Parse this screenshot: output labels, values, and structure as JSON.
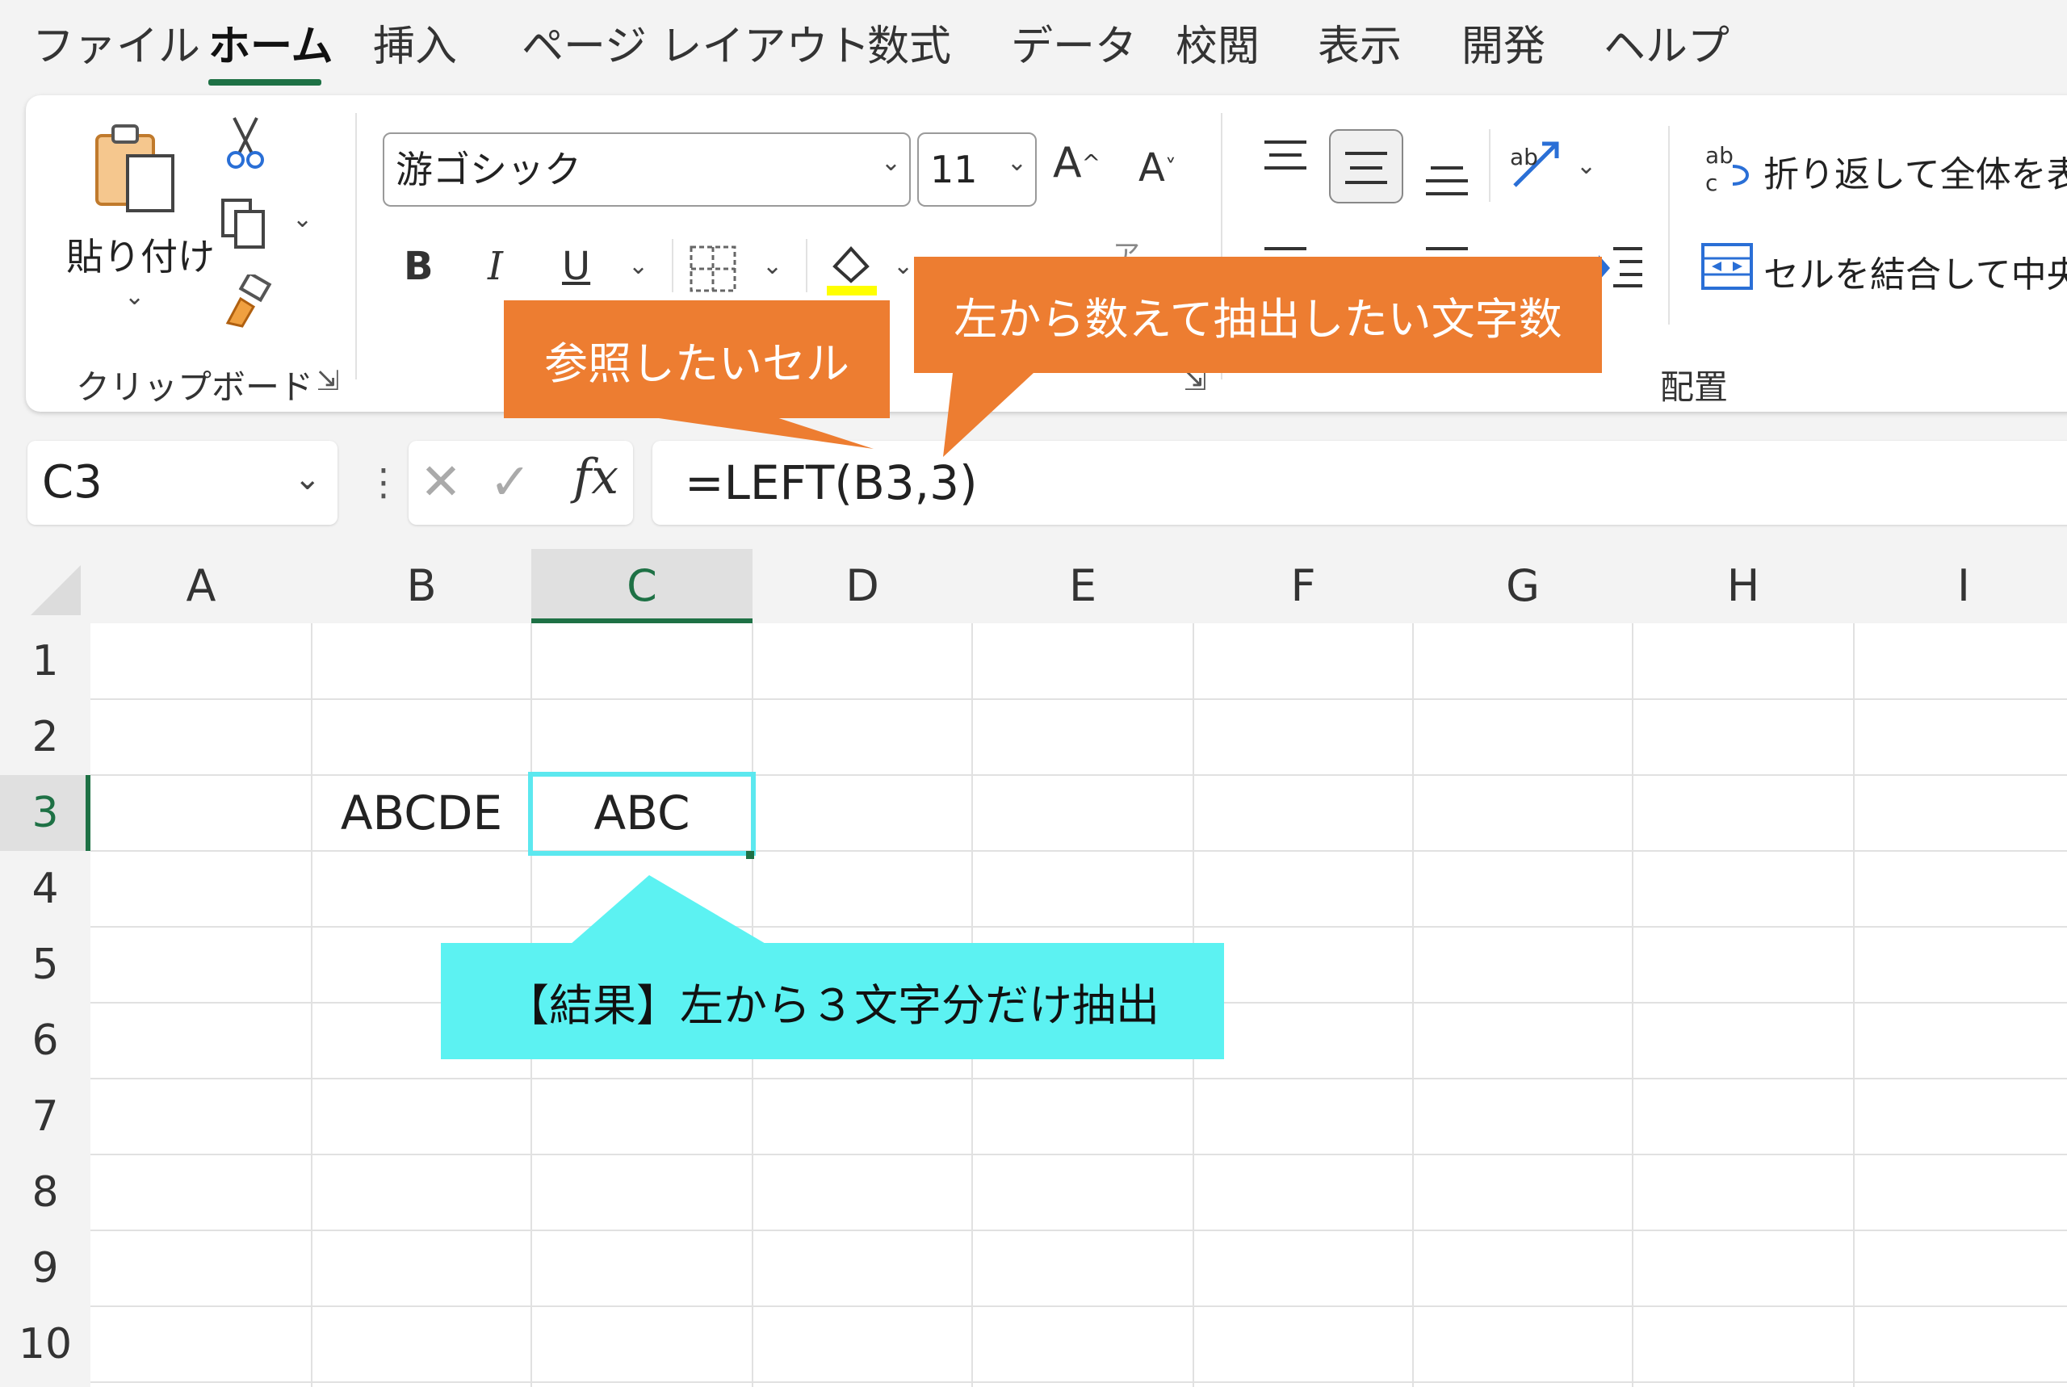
{
  "menu": {
    "tabs": [
      "ファイル",
      "ホーム",
      "挿入",
      "ページ レイアウト",
      "数式",
      "データ",
      "校閲",
      "表示",
      "開発",
      "ヘルプ"
    ],
    "active_tab": "ホーム"
  },
  "ribbon": {
    "clipboard": {
      "paste_label": "貼り付け",
      "group_label": "クリップボード"
    },
    "font": {
      "font_name": "游ゴシック",
      "font_size": "11",
      "grow_label": "A",
      "shrink_label": "A",
      "bold": "B",
      "italic": "I",
      "underline": "U"
    },
    "alignment": {
      "wrap_text": "折り返して全体を表",
      "merge_center": "セルを結合して中央",
      "group_label": "配置"
    }
  },
  "formula_bar": {
    "name_box": "C3",
    "fx_label": "fx",
    "formula": "=LEFT(B3,3)"
  },
  "sheet": {
    "columns": [
      "A",
      "B",
      "C",
      "D",
      "E",
      "F",
      "G",
      "H",
      "I"
    ],
    "rows": [
      "1",
      "2",
      "3",
      "4",
      "5",
      "6",
      "7",
      "8",
      "9",
      "10"
    ],
    "selected_cell": "C3",
    "cells": {
      "B3": "ABCDE",
      "C3": "ABC"
    }
  },
  "callouts": {
    "reference_cell": "参照したいセル",
    "char_count": "左から数えて抽出したい文字数",
    "result": "【結果】左から３文字分だけ抽出"
  },
  "colors": {
    "accent_green": "#1e7145",
    "callout_orange": "#ed7d31",
    "callout_cyan": "#5cf2f2",
    "selection_border": "#5ce8ef",
    "fill_yellow": "#ffff00"
  }
}
